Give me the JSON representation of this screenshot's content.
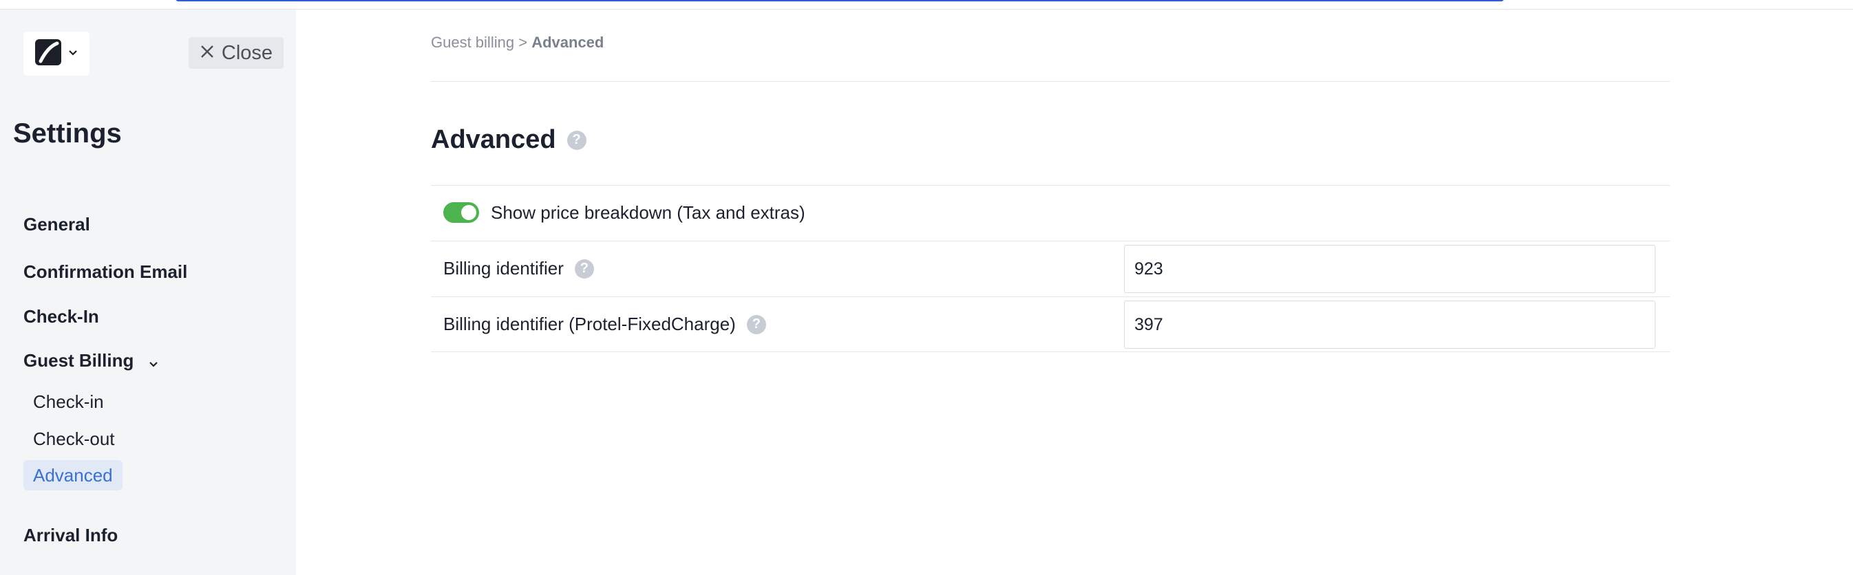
{
  "sidebar": {
    "close_label": "Close",
    "title": "Settings",
    "nav": {
      "general": "General",
      "confirmation_email": "Confirmation Email",
      "check_in": "Check-In",
      "guest_billing": "Guest Billing",
      "arrival_info": "Arrival Info"
    },
    "guest_billing_sub": {
      "check_in": "Check-in",
      "check_out": "Check-out",
      "advanced": "Advanced"
    }
  },
  "breadcrumb": {
    "parent": "Guest billing",
    "separator": ">",
    "current": "Advanced"
  },
  "page": {
    "title": "Advanced",
    "help_glyph": "?"
  },
  "settings": {
    "price_breakdown_label": "Show price breakdown (Tax and extras)",
    "price_breakdown_enabled": true,
    "billing_identifier_label": "Billing identifier",
    "billing_identifier_value": "923",
    "billing_identifier_protel_label": "Billing identifier (Protel-FixedCharge)",
    "billing_identifier_protel_value": "397"
  },
  "colors": {
    "accent": "#3a6fd4",
    "toggle_on": "#4cb34f",
    "top_bar": "#2f5fd6"
  }
}
